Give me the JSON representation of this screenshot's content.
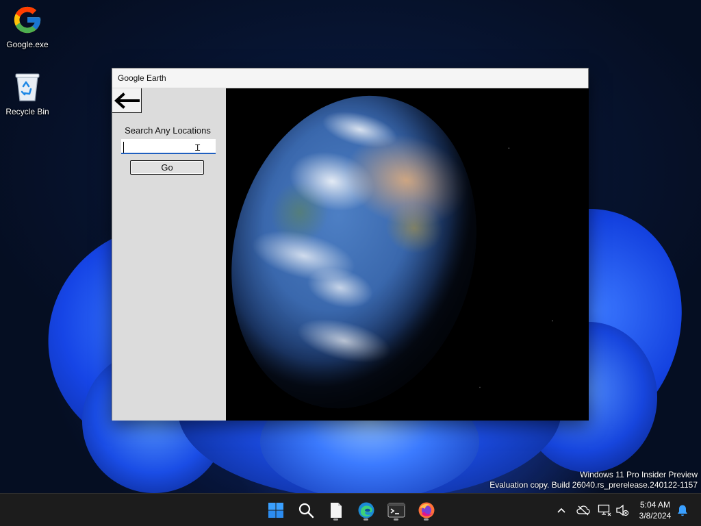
{
  "desktop": {
    "icons": [
      {
        "label": "Google.exe",
        "icon": "google-g-icon"
      },
      {
        "label": "Recycle Bin",
        "icon": "recycle-bin-icon"
      }
    ]
  },
  "window": {
    "title": "Google Earth",
    "back_icon": "left-arrow-icon",
    "search_label": "Search Any Locations",
    "search_value": "",
    "search_placeholder": "",
    "go_label": "Go",
    "viewport": "earth-globe-image"
  },
  "watermark": {
    "line1": "Windows 11 Pro Insider Preview",
    "line2": "Evaluation copy. Build 26040.rs_prerelease.240122-1157"
  },
  "taskbar": {
    "apps": [
      "start-icon",
      "search-icon",
      "file-icon",
      "edge-icon",
      "terminal-icon",
      "firefox-icon"
    ],
    "tray_icons": [
      "chevron-up-icon",
      "cloud-offline-icon",
      "network-icon",
      "volume-muted-icon",
      "bell-icon"
    ],
    "time": "5:04 AM",
    "date": "3/8/2024"
  },
  "colors": {
    "accent": "#1f5fbf",
    "taskbar": "#1c1c1c",
    "sidebar": "#dcdcdc",
    "viewport_bg": "#000000"
  }
}
